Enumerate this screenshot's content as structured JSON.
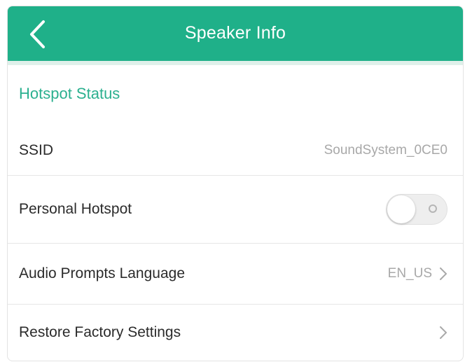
{
  "header": {
    "title": "Speaker Info",
    "back_icon": "chevron-left-icon",
    "background_color": "#1fb089"
  },
  "section": {
    "title": "Hotspot Status",
    "color": "#2bb08f"
  },
  "rows": {
    "ssid": {
      "label": "SSID",
      "value": "SoundSystem_0CE0"
    },
    "personal_hotspot": {
      "label": "Personal Hotspot",
      "toggle_state": "off"
    },
    "audio_prompts_language": {
      "label": "Audio Prompts Language",
      "value": "EN_US",
      "chevron": ">"
    },
    "restore_factory_settings": {
      "label": "Restore Factory Settings",
      "chevron": ">"
    }
  }
}
